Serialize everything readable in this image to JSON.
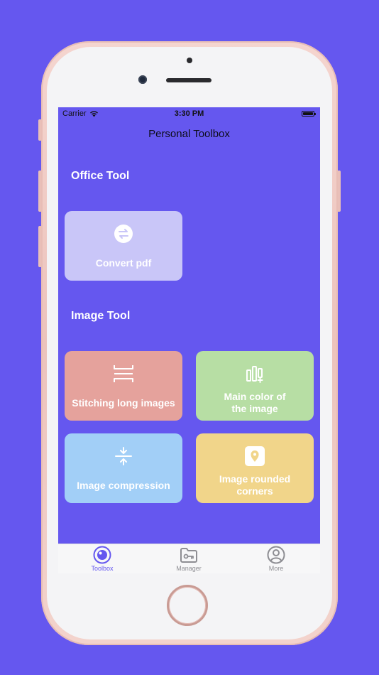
{
  "status_bar": {
    "carrier": "Carrier",
    "time": "3:30 PM"
  },
  "nav": {
    "title": "Personal Toolbox"
  },
  "sections": [
    {
      "title": "Office Tool",
      "tools": [
        {
          "label": "Convert pdf",
          "icon": "convert-arrows-icon",
          "color": "#c9c6f8"
        }
      ]
    },
    {
      "title": "Image Tool",
      "tools": [
        {
          "label": "Stitching long images",
          "icon": "stitch-icon",
          "color": "#e5a29c"
        },
        {
          "label": "Main color of the image",
          "icon": "color-bars-icon",
          "color": "#b7dea4"
        },
        {
          "label": "Image compression",
          "icon": "compress-icon",
          "color": "#a2cff7"
        },
        {
          "label": "Image rounded corners",
          "icon": "rounded-corner-icon",
          "color": "#f1d58a"
        }
      ]
    }
  ],
  "tab_bar": {
    "items": [
      {
        "label": "Toolbox",
        "icon": "toolbox-icon",
        "active": true
      },
      {
        "label": "Manager",
        "icon": "folder-key-icon",
        "active": false
      },
      {
        "label": "More",
        "icon": "user-circle-icon",
        "active": false
      }
    ]
  },
  "colors": {
    "background": "#6557ef",
    "accent": "#6557ef",
    "inactive_tab": "#8e8e93"
  }
}
